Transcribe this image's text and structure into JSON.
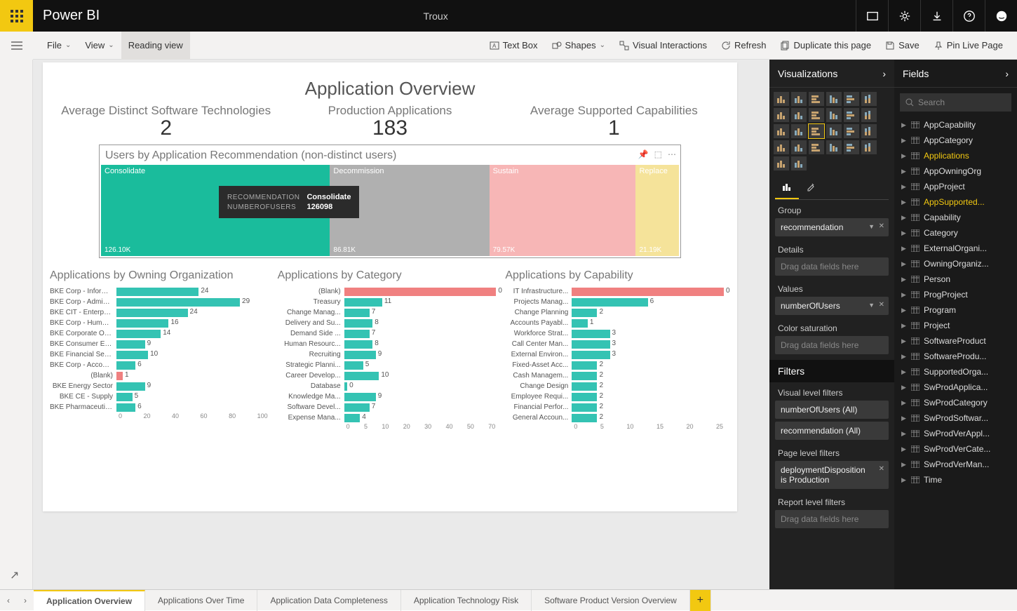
{
  "app": {
    "name": "Power BI",
    "report_name": "Troux"
  },
  "ribbon": {
    "file": "File",
    "view": "View",
    "reading": "Reading view",
    "textbox": "Text Box",
    "shapes": "Shapes",
    "visual_interactions": "Visual Interactions",
    "refresh": "Refresh",
    "duplicate": "Duplicate this page",
    "save": "Save",
    "pin": "Pin Live Page"
  },
  "report": {
    "title": "Application Overview",
    "kpi1_label": "Average Distinct Software Technologies",
    "kpi1_val": "2",
    "kpi2_label": "Production Applications",
    "kpi2_val": "183",
    "kpi3_label": "Average Supported Capabilities",
    "kpi3_val": "1",
    "treemap_title": "Users by Application Recommendation (non-distinct users)",
    "tooltip": {
      "k1": "RECOMMENDATION",
      "v1": "Consolidate",
      "k2": "NUMBEROFUSERS",
      "v2": "126098"
    }
  },
  "chart_data": [
    {
      "type": "treemap",
      "title": "Users by Application Recommendation (non-distinct users)",
      "series": [
        {
          "name": "Consolidate",
          "value": 126100,
          "label": "126.10K",
          "color": "#1abc9c"
        },
        {
          "name": "Decommission",
          "value": 86810,
          "label": "86.81K",
          "color": "#b0b0b0"
        },
        {
          "name": "Sustain",
          "value": 79570,
          "label": "79.57K",
          "color": "#f7b6b6"
        },
        {
          "name": "Replace",
          "value": 21190,
          "label": "21.19K",
          "color": "#f5e39a"
        }
      ]
    },
    {
      "type": "bar",
      "title": "Applications by Owning Organization",
      "xlim": [
        0,
        100
      ],
      "ticks": [
        0,
        20,
        40,
        60,
        80,
        100
      ],
      "categories": [
        "BKE Corp - Informa...",
        "BKE Corp - Adminis...",
        "BKE CIT - Enterprise...",
        "BKE Corp - Human ...",
        "BKE Corporate Ope...",
        "BKE Consumer Elec...",
        "BKE Financial Servic...",
        "BKE Corp - Account...",
        "(Blank)",
        "BKE Energy Sector",
        "BKE CE - Supply",
        "BKE Pharmaceuticals"
      ],
      "values": [
        24,
        29,
        24,
        16,
        14,
        9,
        10,
        6,
        1,
        9,
        5,
        6
      ],
      "colors": [
        "#34c3b3",
        "#34c3b3",
        "#34c3b3",
        "#34c3b3",
        "#34c3b3",
        "#34c3b3",
        "#34c3b3",
        "#34c3b3",
        "#f08080",
        "#34c3b3",
        "#34c3b3",
        "#34c3b3"
      ],
      "widths": [
        52,
        78,
        45,
        33,
        28,
        18,
        20,
        12,
        4,
        18,
        10,
        12
      ]
    },
    {
      "type": "bar",
      "title": "Applications by Category",
      "xlim": [
        0,
        70
      ],
      "ticks": [
        0,
        5,
        10,
        20,
        30,
        40,
        50,
        70
      ],
      "categories": [
        "(Blank)",
        "Treasury",
        "Change Manag...",
        "Delivery and Su...",
        "Demand Side ...",
        "Human Resourc...",
        "Recruiting",
        "Strategic Planni...",
        "Career Develop...",
        "Database",
        "Knowledge Ma...",
        "Software Devel...",
        "Expense Mana..."
      ],
      "values": [
        0,
        11,
        7,
        8,
        7,
        8,
        9,
        5,
        10,
        0,
        9,
        7,
        4
      ],
      "colors": [
        "#f08080",
        "#34c3b3",
        "#34c3b3",
        "#34c3b3",
        "#34c3b3",
        "#34c3b3",
        "#34c3b3",
        "#34c3b3",
        "#34c3b3",
        "#34c3b3",
        "#34c3b3",
        "#34c3b3",
        "#34c3b3"
      ],
      "widths": [
        96,
        24,
        16,
        18,
        16,
        18,
        20,
        12,
        22,
        2,
        20,
        16,
        10
      ]
    },
    {
      "type": "bar",
      "title": "Applications by Capability",
      "xlim": [
        0,
        25
      ],
      "ticks": [
        0,
        5,
        10,
        15,
        20,
        25
      ],
      "categories": [
        "IT Infrastructure...",
        "Projects Manag...",
        "Change Planning",
        "Accounts Payabl...",
        "Workforce Strat...",
        "Call Center Man...",
        "External Environ...",
        "Fixed-Asset Acc...",
        "Cash Managem...",
        "Change Design",
        "Employee Requi...",
        "Financial Perfor...",
        "General Accoun..."
      ],
      "values": [
        0,
        6,
        2,
        1,
        3,
        3,
        3,
        2,
        2,
        2,
        2,
        2,
        2
      ],
      "colors": [
        "#f08080",
        "#34c3b3",
        "#34c3b3",
        "#34c3b3",
        "#34c3b3",
        "#34c3b3",
        "#34c3b3",
        "#34c3b3",
        "#34c3b3",
        "#34c3b3",
        "#34c3b3",
        "#34c3b3",
        "#34c3b3"
      ],
      "widths": [
        96,
        48,
        16,
        10,
        24,
        24,
        24,
        16,
        16,
        16,
        16,
        16,
        16
      ]
    }
  ],
  "viz": {
    "title": "Visualizations",
    "group_label": "Group",
    "group_val": "recommendation",
    "details_label": "Details",
    "details_ph": "Drag data fields here",
    "values_label": "Values",
    "values_val": "numberOfUsers",
    "colorsat_label": "Color saturation",
    "colorsat_ph": "Drag data fields here",
    "filters_head": "Filters",
    "vlf_label": "Visual level filters",
    "vlf1": "numberOfUsers (All)",
    "vlf2": "recommendation (All)",
    "plf_label": "Page level filters",
    "plf1a": "deploymentDisposition",
    "plf1b": "is Production",
    "rlf_label": "Report level filters",
    "rlf_ph": "Drag data fields here"
  },
  "fields": {
    "title": "Fields",
    "search_ph": "Search",
    "items": [
      {
        "n": "AppCapability"
      },
      {
        "n": "AppCategory"
      },
      {
        "n": "Applications",
        "hl": true
      },
      {
        "n": "AppOwningOrg"
      },
      {
        "n": "AppProject"
      },
      {
        "n": "AppSupported...",
        "hl": true
      },
      {
        "n": "Capability"
      },
      {
        "n": "Category"
      },
      {
        "n": "ExternalOrgani..."
      },
      {
        "n": "OwningOrganiz..."
      },
      {
        "n": "Person"
      },
      {
        "n": "ProgProject"
      },
      {
        "n": "Program"
      },
      {
        "n": "Project"
      },
      {
        "n": "SoftwareProduct"
      },
      {
        "n": "SoftwareProdu..."
      },
      {
        "n": "SupportedOrga..."
      },
      {
        "n": "SwProdApplica..."
      },
      {
        "n": "SwProdCategory"
      },
      {
        "n": "SwProdSoftwar..."
      },
      {
        "n": "SwProdVerAppl..."
      },
      {
        "n": "SwProdVerCate..."
      },
      {
        "n": "SwProdVerMan..."
      },
      {
        "n": "Time"
      }
    ]
  },
  "tabs": [
    "Application Overview",
    "Applications Over Time",
    "Application Data Completeness",
    "Application Technology Risk",
    "Software Product Version Overview"
  ]
}
